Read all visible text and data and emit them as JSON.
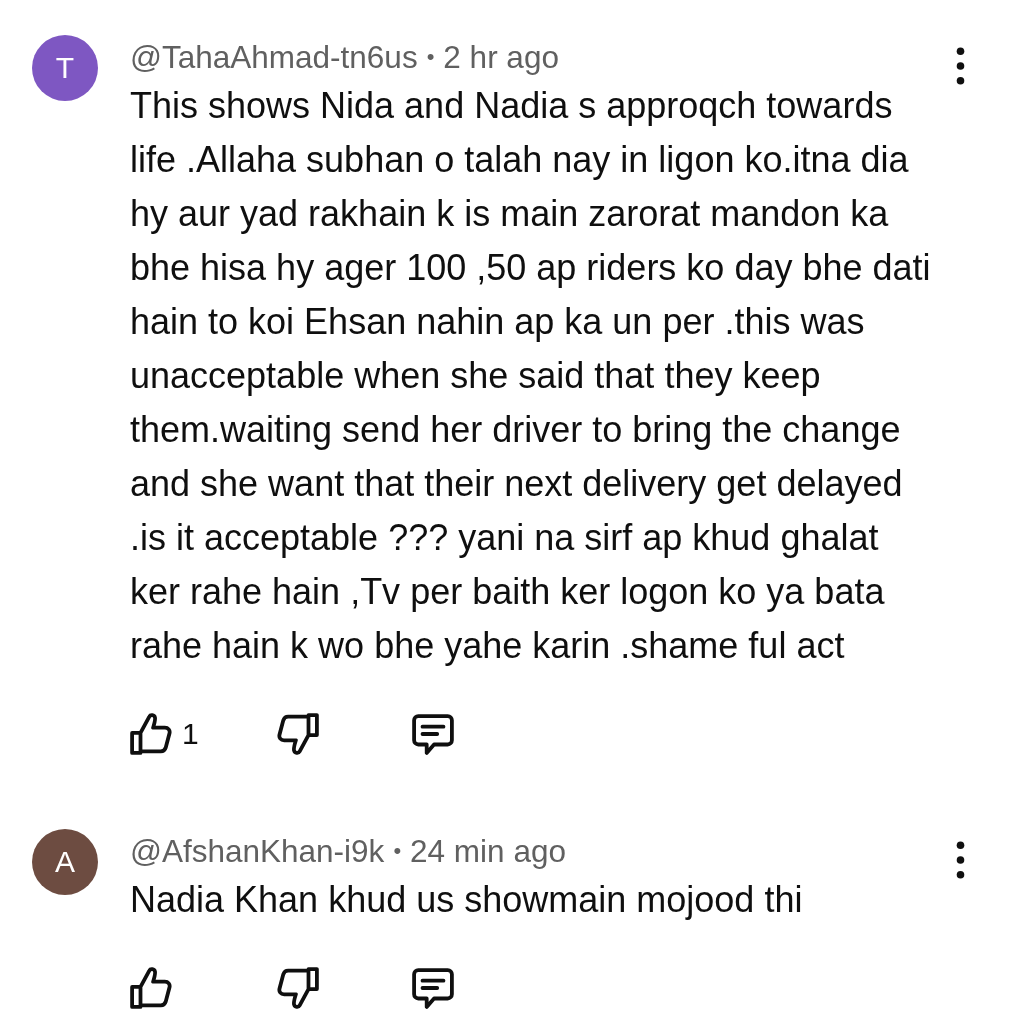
{
  "comments": [
    {
      "avatar": {
        "letter": "T",
        "color": "#7e57c2"
      },
      "author": "@TahaAhmad-tn6us",
      "separator": "•",
      "time": "2 hr ago",
      "text": "This shows Nida and Nadia s approqch towards life .Allaha subhan o talah nay in ligon ko.itna dia hy aur yad rakhain k is main zarorat mandon ka bhe hisa hy ager 100 ,50 ap riders ko day bhe dati hain to koi Ehsan nahin ap ka un per .this was unacceptable when she said that they keep them.waiting send her driver to bring the change and she want that their next delivery get delayed .is it acceptable ??? yani na sirf ap khud ghalat ker rahe hain ,Tv per baith ker logon ko ya bata rahe hain k wo bhe yahe karin .shame ful act",
      "likes": "1"
    },
    {
      "avatar": {
        "letter": "A",
        "color": "#6d4c41"
      },
      "author": "@AfshanKhan-i9k",
      "separator": "•",
      "time": "24 min ago",
      "text": "Nadia Khan khud us showmain mojood thi"
    }
  ]
}
